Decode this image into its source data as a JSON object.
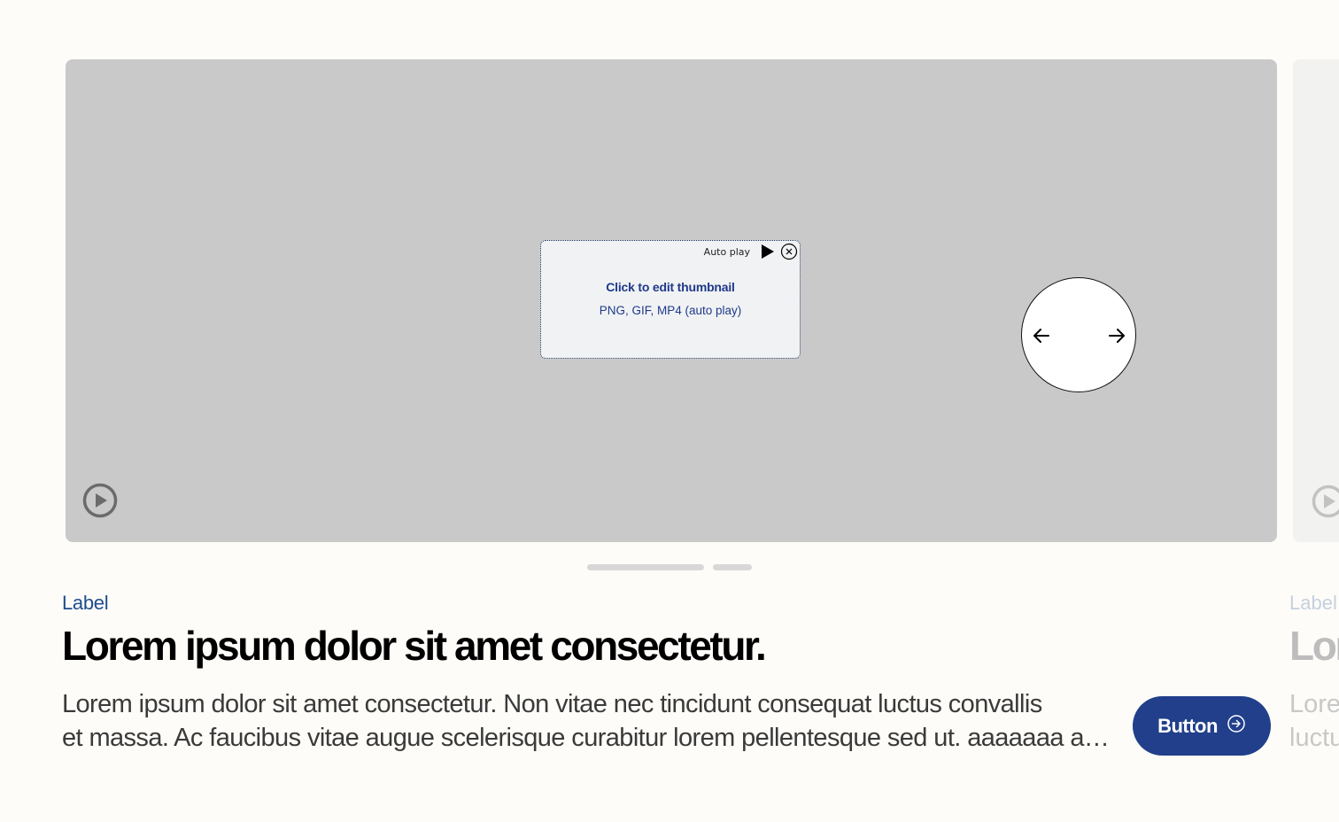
{
  "media": {
    "background_color": "#c9c9c9",
    "thumbnail": {
      "autoplay_label": "Auto play",
      "title": "Click to edit thumbnail",
      "subtitle": "PNG, GIF, MP4 (auto play)",
      "play_icon": "play-triangle-icon",
      "close_icon": "close-circle-icon"
    },
    "nav": {
      "prev_icon": "arrow-left-icon",
      "next_icon": "arrow-right-icon"
    },
    "play_icon": "play-circle-icon"
  },
  "pagination": {
    "active_index": 0,
    "count": 2
  },
  "content": {
    "label": "Label",
    "headline": "Lorem ipsum dolor sit amet consectetur.",
    "body_line_1": "Lorem ipsum dolor sit amet consectetur. Non vitae nec tincidunt consequat luctus convallis",
    "body_line_2": "et massa. Ac faucibus vitae augue scelerisque curabitur lorem pellentesque sed ut. aaaaaaa aaaaaaa",
    "button_label": "Button",
    "button_icon": "arrow-right-circle-icon"
  },
  "peek": {
    "label": "Label",
    "headline": "Lor",
    "body_line_1": "Lore",
    "body_line_2": "luctu"
  },
  "colors": {
    "accent": "#213f8a",
    "label": "#1e4d8c",
    "page_bg": "#fdfcf8"
  }
}
